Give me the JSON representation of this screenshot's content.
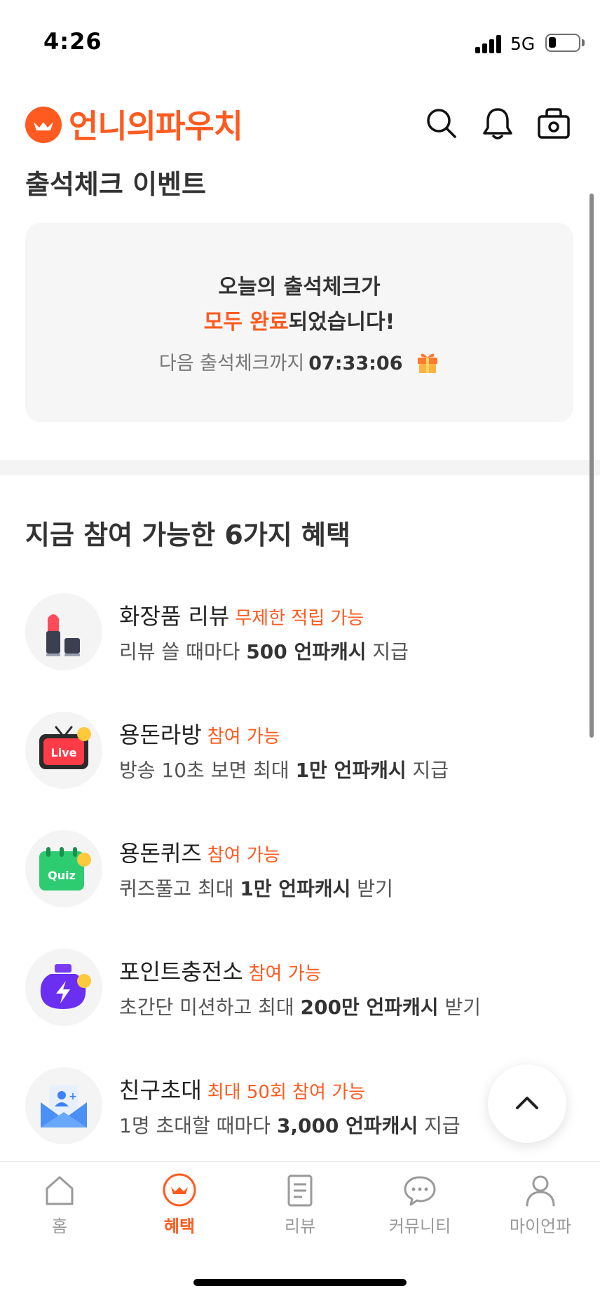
{
  "status_bar": {
    "time": "4:26",
    "network": "5G",
    "battery_level": 0.25
  },
  "header": {
    "app_name": "언니의파우치",
    "brand_color": "#ff5a1f"
  },
  "attendance": {
    "section_title": "출석체크 이벤트",
    "line1": "오늘의 출석체크가",
    "line2_highlight": "모두 완료",
    "line2_rest": "되었습니다!",
    "next_label": "다음 출석체크까지",
    "countdown": "07:33:06"
  },
  "benefits": {
    "section_title": "지금 참여 가능한 6가지 혜택",
    "items": [
      {
        "name": "화장품 리뷰",
        "tag": "무제한 적립 가능",
        "desc_pre": "리뷰 쓸 때마다 ",
        "desc_bold": "500 언파캐시",
        "desc_post": " 지급",
        "icon": "lipstick-icon"
      },
      {
        "name": "용돈라방",
        "tag": "참여 가능",
        "desc_pre": "방송 10초 보면 최대 ",
        "desc_bold": "1만 언파캐시",
        "desc_post": " 지급",
        "icon": "live-tv-icon"
      },
      {
        "name": "용돈퀴즈",
        "tag": "참여 가능",
        "desc_pre": "퀴즈풀고 최대 ",
        "desc_bold": "1만 언파캐시",
        "desc_post": " 받기",
        "icon": "quiz-calendar-icon"
      },
      {
        "name": "포인트충전소",
        "tag": "참여 가능",
        "desc_pre": "초간단 미션하고 최대 ",
        "desc_bold": "200만 언파캐시",
        "desc_post": " 받기",
        "icon": "charge-bottle-icon"
      },
      {
        "name": "친구초대",
        "tag": "최대 50회 참여 가능",
        "desc_pre": "1명 초대할 때마다 ",
        "desc_bold": "3,000 언파캐시",
        "desc_post": " 지급",
        "icon": "invite-envelope-icon"
      }
    ]
  },
  "nav": {
    "items": [
      {
        "label": "홈",
        "icon": "home-icon",
        "active": false
      },
      {
        "label": "혜택",
        "icon": "benefit-logo-icon",
        "active": true
      },
      {
        "label": "리뷰",
        "icon": "review-doc-icon",
        "active": false
      },
      {
        "label": "커뮤니티",
        "icon": "chat-bubble-icon",
        "active": false
      },
      {
        "label": "마이언파",
        "icon": "profile-icon",
        "active": false
      }
    ]
  }
}
